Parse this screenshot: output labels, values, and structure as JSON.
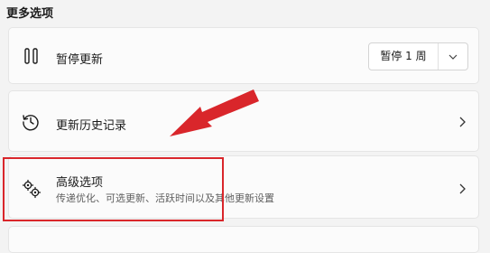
{
  "section": {
    "title": "更多选项"
  },
  "pause": {
    "label": "暂停更新",
    "button_label": "暂停 1 周",
    "icon": "pause-icon",
    "dropdown_icon": "chevron-down-icon"
  },
  "history": {
    "label": "更新历史记录",
    "icon": "history-icon"
  },
  "advanced": {
    "label": "高级选项",
    "description": "传递优化、可选更新、活跃时间以及其他更新设置",
    "icon": "gears-icon"
  },
  "annotation": {
    "color": "#d9262b"
  }
}
